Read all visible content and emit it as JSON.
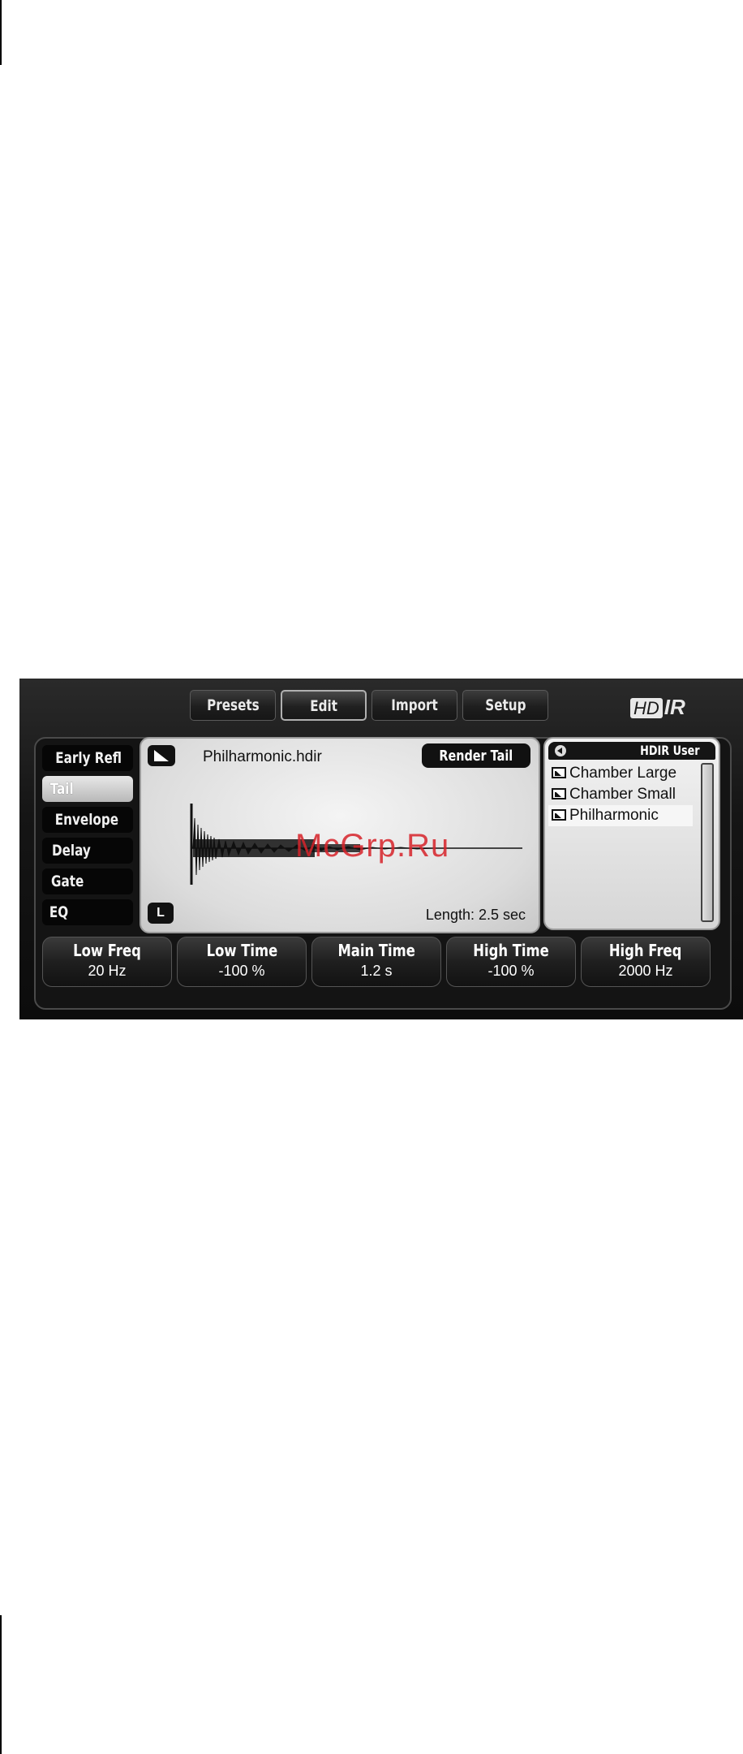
{
  "top_tabs": [
    "Presets",
    "Edit",
    "Import",
    "Setup"
  ],
  "active_top_tab": "Edit",
  "logo": {
    "hd": "HD",
    "rest": "IR"
  },
  "nav": {
    "items": [
      "Early Refl",
      "Tail",
      "Envelope",
      "Delay",
      "Gate",
      "EQ"
    ],
    "active": "Tail"
  },
  "center": {
    "file_name": "Philharmonic.hdir",
    "render_button": "Render Tail",
    "channel_button": "L",
    "length_label": "Length: 2.5 sec"
  },
  "browser": {
    "title": "HDIR User",
    "presets": [
      "Chamber Large",
      "Chamber Small",
      "Philharmonic"
    ],
    "selected": "Philharmonic"
  },
  "params": [
    {
      "label": "Low Freq",
      "value": "20 Hz"
    },
    {
      "label": "Low Time",
      "value": "-100 %"
    },
    {
      "label": "Main Time",
      "value": "1.2 s"
    },
    {
      "label": "High Time",
      "value": "-100 %"
    },
    {
      "label": "High Freq",
      "value": "2000 Hz"
    }
  ],
  "watermark": "McGrp.Ru",
  "colors": {
    "watermark": "#d7232a",
    "panel_bg": "#141414",
    "display_bg": "#e6e6e6"
  }
}
